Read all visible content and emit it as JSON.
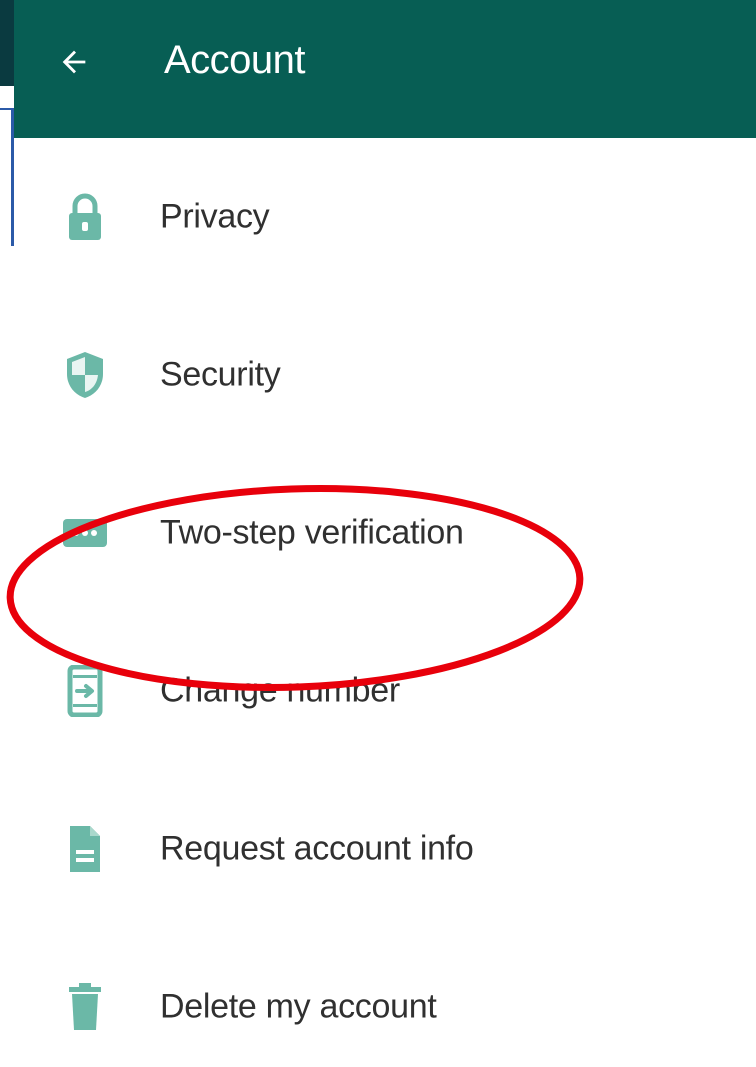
{
  "header": {
    "title": "Account",
    "back_icon": "arrow-left-icon",
    "background_color": "#075e54",
    "title_color": "#ffffff"
  },
  "menu": {
    "icon_color": "#6bb8a7",
    "items": [
      {
        "label": "Privacy",
        "icon": "lock-icon"
      },
      {
        "label": "Security",
        "icon": "shield-icon"
      },
      {
        "label": "Two-step verification",
        "icon": "dots-keypad-icon"
      },
      {
        "label": "Change number",
        "icon": "phone-arrow-icon"
      },
      {
        "label": "Request account info",
        "icon": "document-icon"
      },
      {
        "label": "Delete my account",
        "icon": "trash-icon"
      }
    ]
  },
  "annotation": {
    "type": "ellipse",
    "color": "#e8000b",
    "target": "Two-step verification"
  }
}
